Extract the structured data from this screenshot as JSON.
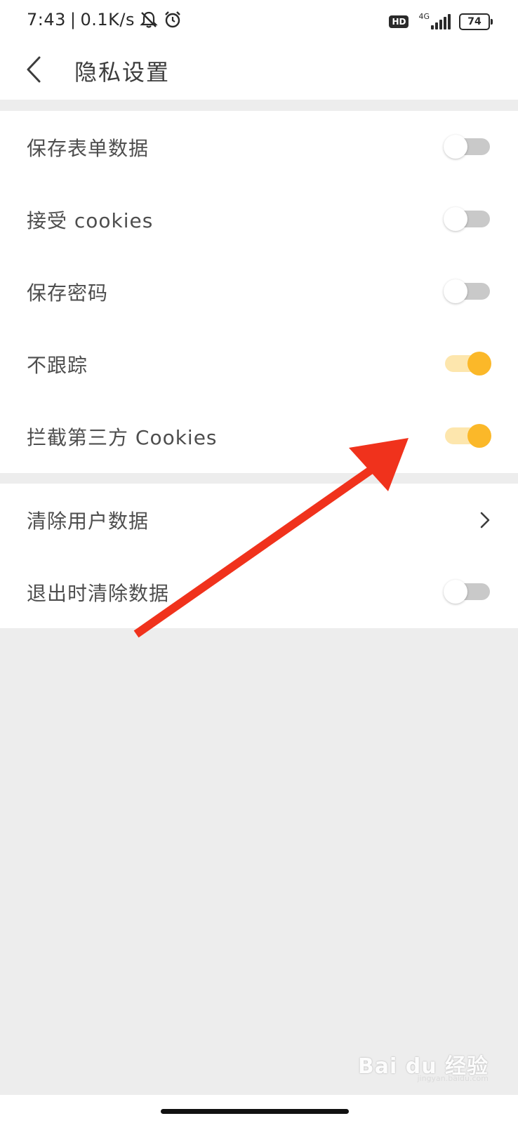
{
  "status_bar": {
    "time": "7:43",
    "separator": "|",
    "net_speed": "0.1K/s",
    "hd_label": "HD",
    "network_type": "4G",
    "battery_level": "74",
    "icons": [
      "bell-muted-icon",
      "alarm-clock-icon",
      "signal-icon",
      "battery-icon"
    ]
  },
  "header": {
    "title": "隐私设置",
    "back_icon": "chevron-left-icon"
  },
  "settings": {
    "section1": [
      {
        "label": "保存表单数据",
        "type": "toggle",
        "on": false
      },
      {
        "label": "接受 cookies",
        "type": "toggle",
        "on": false
      },
      {
        "label": "保存密码",
        "type": "toggle",
        "on": false
      },
      {
        "label": "不跟踪",
        "type": "toggle",
        "on": true
      },
      {
        "label": "拦截第三方 Cookies",
        "type": "toggle",
        "on": true
      }
    ],
    "section2": [
      {
        "label": "清除用户数据",
        "type": "link",
        "icon": "chevron-right-icon"
      },
      {
        "label": "退出时清除数据",
        "type": "toggle",
        "on": false
      }
    ]
  },
  "watermark": {
    "logo": "Bai du 经验",
    "url": "jingyan.baidu.com"
  },
  "colors": {
    "toggle_on_knob": "#fbb829",
    "toggle_on_track": "#fde6ad",
    "toggle_off_track": "#c9c9c9",
    "annotation_arrow": "#f0321c",
    "background": "#ededed"
  }
}
